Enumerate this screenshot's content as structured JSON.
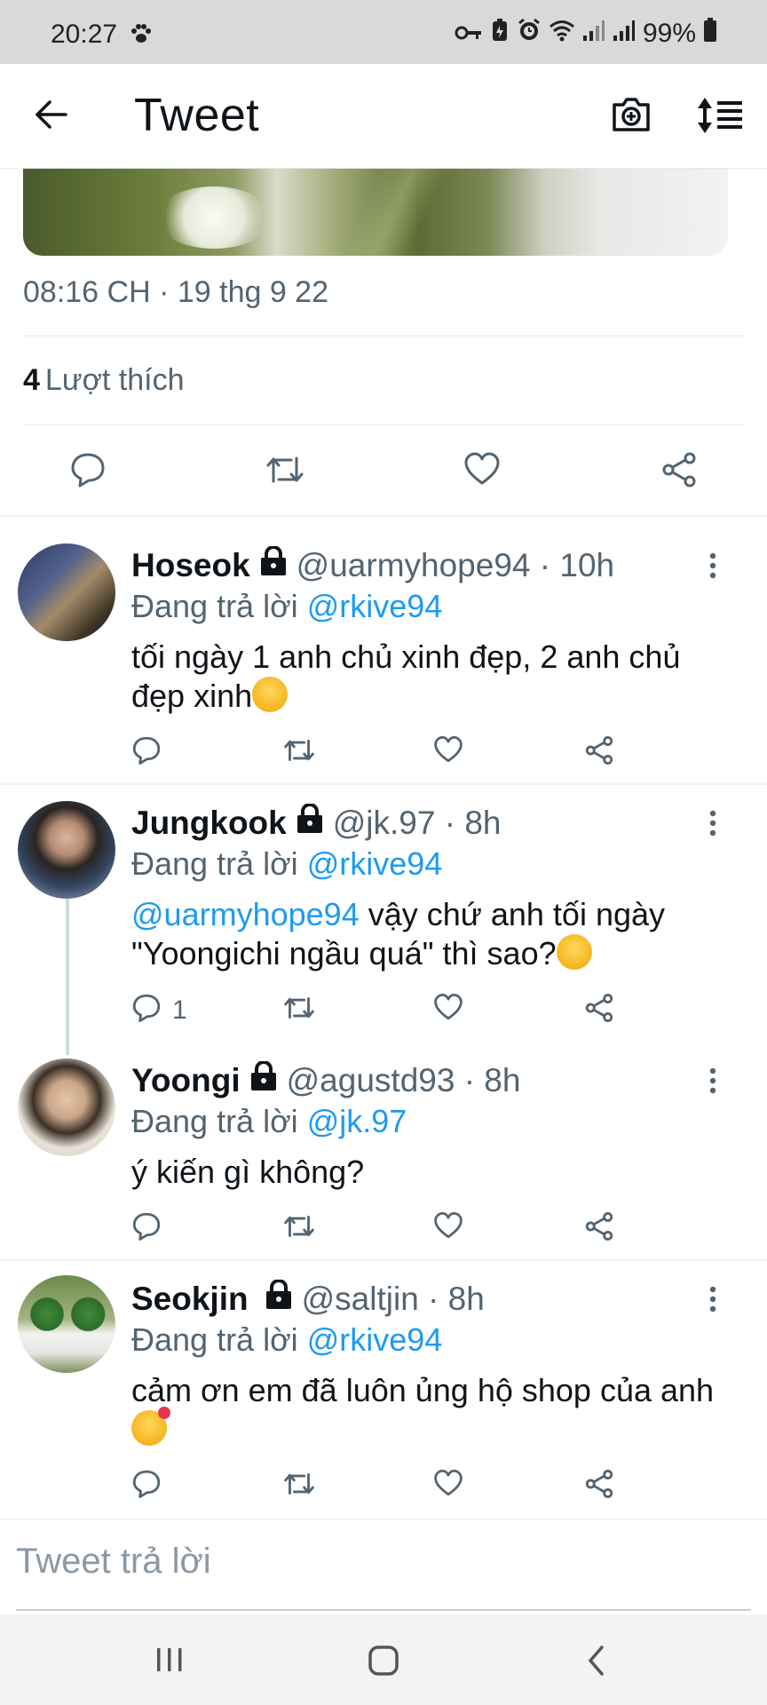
{
  "status_bar": {
    "time": "20:27",
    "battery": "99%",
    "icons": [
      "paw-icon",
      "key-icon",
      "battery-saver-icon",
      "alarm-icon",
      "wifi-icon",
      "signal-icon",
      "signal-icon",
      "battery-icon"
    ]
  },
  "header": {
    "title": "Tweet",
    "icons": [
      "back-arrow-icon",
      "camera-add-icon",
      "sort-icon"
    ]
  },
  "tweet": {
    "timestamp": "08:16 CH · 19 thg 9 22",
    "likes_count": "4",
    "likes_label": "Lượt thích",
    "actions": [
      "reply-icon",
      "retweet-icon",
      "like-icon",
      "share-icon"
    ]
  },
  "replies": [
    {
      "name": "Hoseok",
      "handle": "@uarmyhope94 · 10h",
      "replying_prefix": "Đang trả lời",
      "replying_to": "@rkive94",
      "text": "tối ngày 1 anh chủ xinh đẹp, 2 anh chủ đẹp xinh",
      "emoji": "unamused-face",
      "reply_count": ""
    },
    {
      "name": "Jungkook",
      "handle": "@jk.97 · 8h",
      "replying_prefix": "Đang trả lời",
      "replying_to": "@rkive94",
      "mention": "@uarmyhope94",
      "text": " vậy chứ anh tối ngày \"Yoongichi ngầu quá\" thì sao?",
      "emoji": "relieved-face",
      "reply_count": "1"
    },
    {
      "name": "Yoongi",
      "handle": "@agustd93 · 8h",
      "replying_prefix": "Đang trả lời",
      "replying_to": "@jk.97",
      "text": "ý kiến gì không?",
      "reply_count": ""
    },
    {
      "name": "Seokjin",
      "handle": "@saltjin · 8h",
      "replying_prefix": "Đang trả lời",
      "replying_to": "@rkive94",
      "text": "cảm ơn em đã luôn ủng hộ shop của anh",
      "emoji": "smiling-face-with-hearts",
      "reply_count": ""
    }
  ],
  "reply_input": {
    "placeholder": "Tweet trả lời"
  },
  "nav_bar": {
    "buttons": [
      "recents-icon",
      "home-icon",
      "back-icon"
    ]
  },
  "colors": {
    "link": "#1d9bf0",
    "secondary_text": "#536471",
    "primary_text": "#0f1419"
  }
}
